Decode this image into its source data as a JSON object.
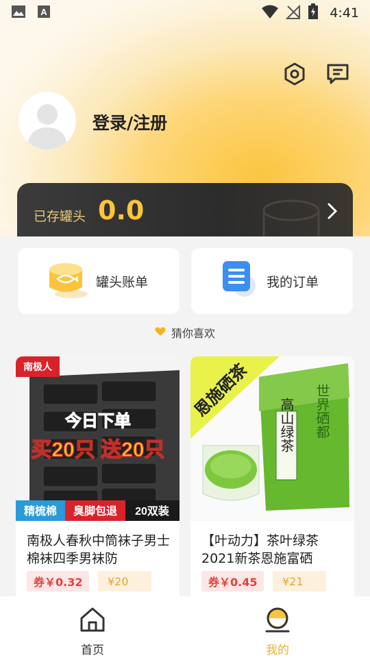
{
  "status_bar": {
    "time": "4:41",
    "left_icons": [
      "image-icon",
      "a-icon"
    ],
    "right_icons": [
      "wifi-icon",
      "signal-icon",
      "battery-icon"
    ]
  },
  "header": {
    "settings_icon": "hexagon-settings-icon",
    "message_icon": "message-icon",
    "login_label": "登录/注册"
  },
  "savings": {
    "label": "已存罐头",
    "value": "0.0"
  },
  "tiles": [
    {
      "label": "罐头账单",
      "icon": "can-icon"
    },
    {
      "label": "我的订单",
      "icon": "order-icon"
    }
  ],
  "guess_label": "猜你喜欢",
  "products": [
    {
      "title": "南极人春秋中筒袜子男士棉袜四季男袜防",
      "coupon": "券￥0.32",
      "price": "¥20",
      "brand": "南极人",
      "image_text": {
        "promo_line1": "今日下单",
        "promo_line2": "买20只 送20只",
        "tag_left": "精梳棉",
        "tag_mid": "臭脚包退",
        "tag_right": "20双装"
      }
    },
    {
      "title": "【叶动力】茶叶绿茶2021新茶恩施富硒",
      "coupon": "券￥0.45",
      "price": "¥21",
      "image_text": {
        "banner": "恩施硒茶",
        "pack_name": "高山绿茶",
        "side_text": "世界硒都"
      }
    }
  ],
  "bottom_nav": [
    {
      "label": "首页",
      "icon": "home-icon",
      "active": false
    },
    {
      "label": "我的",
      "icon": "profile-icon",
      "active": true
    }
  ],
  "colors": {
    "accent": "#fcc43c",
    "active_nav": "#f0b030",
    "coupon_red": "#e2413a"
  }
}
